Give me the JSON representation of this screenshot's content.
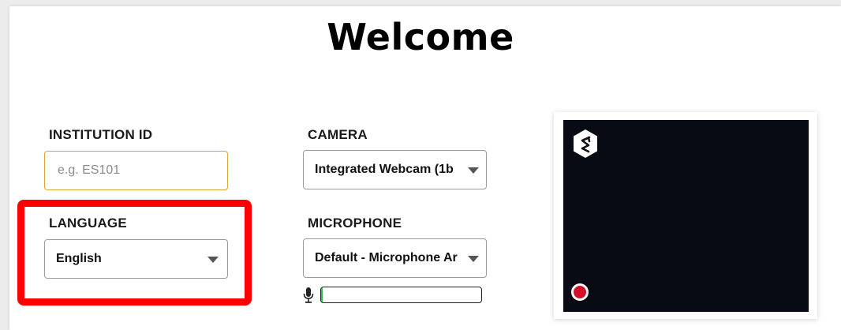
{
  "page": {
    "title": "Welcome"
  },
  "institution": {
    "label": "INSTITUTION ID",
    "placeholder": "e.g. ES101",
    "value": ""
  },
  "language": {
    "label": "LANGUAGE",
    "selected": "English"
  },
  "camera": {
    "label": "CAMERA",
    "selected": "Integrated Webcam (1b"
  },
  "microphone": {
    "label": "MICROPHONE",
    "selected": "Default - Microphone Ar",
    "level_percent": 1
  },
  "colors": {
    "input_border_accent": "#d9a634",
    "highlight_red": "#ff0000",
    "preview_background": "#080a14",
    "record_button_red": "#d3102a",
    "mic_level_green": "#2dbb4d"
  },
  "icons": {
    "brand_logo": "hexagon-s-logo-icon",
    "record": "record-icon",
    "microphone": "microphone-icon",
    "dropdown": "caret-down-icon"
  }
}
